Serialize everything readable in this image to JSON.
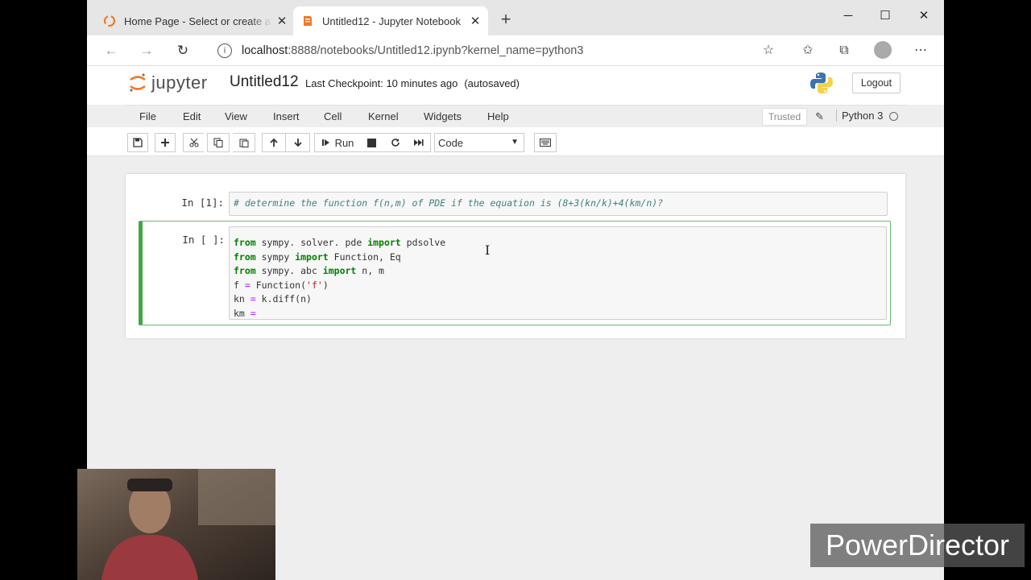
{
  "browser": {
    "tabs": [
      {
        "title": "Home Page - Select or create a n",
        "active": false
      },
      {
        "title": "Untitled12 - Jupyter Notebook",
        "active": true
      }
    ],
    "close_glyph": "✕",
    "new_tab_glyph": "+",
    "window_controls": {
      "minimize": "─",
      "maximize": "☐",
      "close": "✕"
    },
    "address": {
      "host": "localhost",
      "rest": ":8888/notebooks/Untitled12.ipynb?kernel_name=python3"
    },
    "nav": {
      "back": "←",
      "forward": "→",
      "reload": "↻"
    },
    "toolbar_icons": {
      "favorites_add": "☆",
      "favorites": "✩",
      "collections": "⧉",
      "more": "⋯"
    }
  },
  "jupyter": {
    "logo_text": "jupyter",
    "notebook_name": "Untitled12",
    "checkpoint": "Last Checkpoint: 10 minutes ago",
    "autosave": "(autosaved)",
    "logout": "Logout",
    "menu": [
      "File",
      "Edit",
      "View",
      "Insert",
      "Cell",
      "Kernel",
      "Widgets",
      "Help"
    ],
    "trusted": "Trusted",
    "kernel_name": "Python 3",
    "toolbar": {
      "run_label": "Run",
      "cell_type": "Code"
    },
    "cells": [
      {
        "prompt": "In [1]:"
      },
      {
        "prompt": "In [ ]:"
      }
    ]
  },
  "watermark": "PowerDirector",
  "colors": {
    "selected_cell_border": "#42a547",
    "comment": "#408080",
    "keyword": "#008000",
    "string": "#ba2121"
  }
}
